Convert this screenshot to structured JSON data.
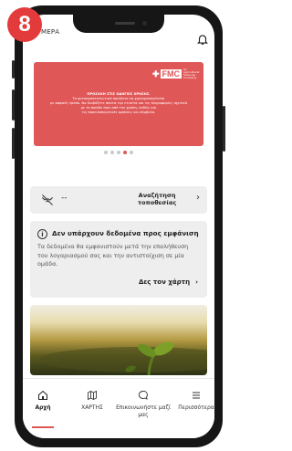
{
  "step_badge": "8",
  "header": {
    "title": "ΜΕΡΑ"
  },
  "banner": {
    "brand": "FMC",
    "tagline": "An Agricultural Sciences Company",
    "heading": "ΠΡΟΣΟΧΗ ΣΤΙΣ ΟΔΗΓΙΕΣ ΧΡΗΣΗΣ.",
    "line1": "Τα φυτοπροστατευτικά προϊόντα να χρησιμοποιούνται",
    "line2": "με ασφαλή τρόπο. Να διαβάζετε πάντα την ετικέτα και τις πληροφορίες σχετικά",
    "line3": "με το προϊόν πριν από την χρήση, καθώς και",
    "line4": "τις προειδοποιητικές φράσεις και σύμβολα."
  },
  "carousel": {
    "count": 5,
    "active_index": 3
  },
  "location": {
    "value": "--",
    "label_line1": "Αναζήτηση",
    "label_line2": "τοποθεσίας",
    "chevron": "›"
  },
  "info": {
    "icon": "i",
    "title": "Δεν υπάρχουν δεδομένα προς εμφάνιση",
    "body": "Τα δεδομένα θα εμφανιστούν μετά την επαλήθευση του λογαριασμού σας και την αντιστοίχιση σε μία ομάδα.",
    "link_label": "Δες τον χάρτη",
    "link_arrow": "›"
  },
  "tabs": [
    {
      "label": "Αρχή",
      "icon": "home-icon"
    },
    {
      "label": "ΧΑΡΤΗΣ",
      "icon": "map-icon"
    },
    {
      "label": "Επικοινωνήστε μαζί μας",
      "icon": "chat-icon"
    },
    {
      "label": "Περισσότερα",
      "icon": "menu-icon"
    }
  ],
  "colors": {
    "accent": "#e05757",
    "badge": "#e33b3b",
    "card": "#eeeeee"
  }
}
